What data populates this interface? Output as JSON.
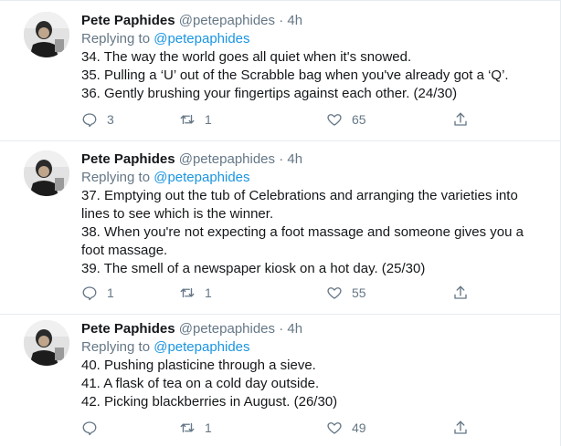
{
  "tweets": [
    {
      "name": "Pete Paphides",
      "handle": "@petepaphides",
      "separator": "·",
      "time": "4h",
      "replying_prefix": "Replying to",
      "replying_to": "@petepaphides",
      "lines": [
        "34. The way the world goes all quiet when it's snowed.",
        "35. Pulling a ‘U’ out of the Scrabble bag when you've already got a ‘Q’.",
        "36. Gently brushing your fingertips against each other. (24/30)"
      ],
      "replies": "3",
      "retweets": "1",
      "likes": "65"
    },
    {
      "name": "Pete Paphides",
      "handle": "@petepaphides",
      "separator": "·",
      "time": "4h",
      "replying_prefix": "Replying to",
      "replying_to": "@petepaphides",
      "lines": [
        "37. Emptying out the tub of Celebrations and arranging the varieties into",
        "lines to see which is the winner.",
        "38. When you're not expecting a foot massage and someone gives you a",
        "foot massage.",
        "39. The smell of a newspaper kiosk on a hot day. (25/30)"
      ],
      "replies": "1",
      "retweets": "1",
      "likes": "55"
    },
    {
      "name": "Pete Paphides",
      "handle": "@petepaphides",
      "separator": "·",
      "time": "4h",
      "replying_prefix": "Replying to",
      "replying_to": "@petepaphides",
      "lines": [
        "40. Pushing plasticine through a sieve.",
        "41. A flask of tea on a cold day outside.",
        "42. Picking blackberries in August. (26/30)"
      ],
      "replies": "",
      "retweets": "1",
      "likes": "49"
    }
  ],
  "icons": {
    "reply": "reply-icon",
    "retweet": "retweet-icon",
    "like": "heart-icon",
    "share": "share-icon"
  },
  "colors": {
    "text": "#14171a",
    "secondary": "#657786",
    "link": "#1b95e0",
    "divider": "#e6ecf0"
  }
}
